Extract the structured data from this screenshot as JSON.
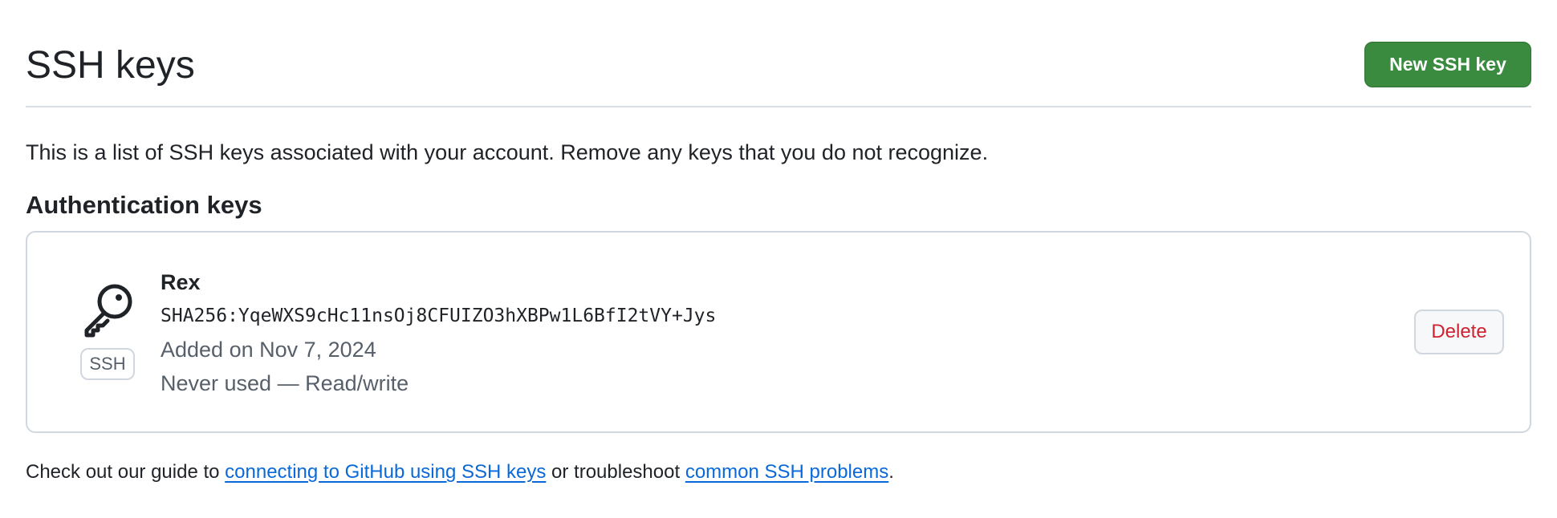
{
  "header": {
    "title": "SSH keys",
    "new_key_label": "New SSH key"
  },
  "intro": "This is a list of SSH keys associated with your account. Remove any keys that you do not recognize.",
  "section": {
    "title": "Authentication keys"
  },
  "keys": [
    {
      "title": "Rex",
      "fingerprint": "SHA256:YqeWXS9cHc11nsOj8CFUIZO3hXBPw1L6BfI2tVY+Jys",
      "added": "Added on Nov 7, 2024",
      "usage": "Never used — Read/write",
      "badge": "SSH",
      "icon": "key-icon",
      "delete_label": "Delete"
    }
  ],
  "footer": {
    "prefix": "Check out our guide to ",
    "link1": "connecting to GitHub using SSH keys",
    "middle": " or troubleshoot ",
    "link2": "common SSH problems",
    "suffix": "."
  },
  "colors": {
    "primary_button": "#3a8a3f",
    "danger_text": "#cf222e",
    "link": "#0969da",
    "muted_text": "#57606a"
  }
}
